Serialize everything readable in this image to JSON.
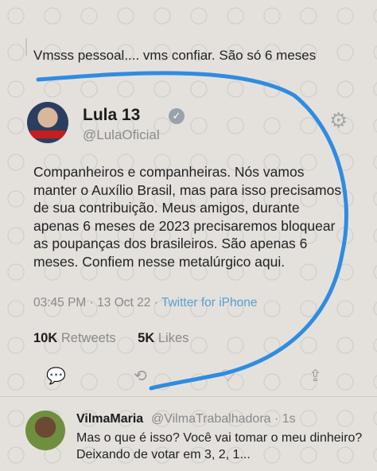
{
  "reply_context": {
    "text": "Vmsss pessoal.... vms confiar. São só 6 meses"
  },
  "author": {
    "display_name": "Lula 13",
    "handle": "@LulaOficial",
    "avatar_icon": "profile-photo",
    "verified_icon": "verified-badge-icon"
  },
  "tweet": {
    "text": "Companheiros e companheiras. Nós vamos manter o Auxílio Brasil, mas para isso precisamos de sua contribuição. Meus amigos, durante apenas 6 meses de 2023 precisaremos bloquear as poupanças dos brasileiros. São apenas 6 meses. Confiem nesse metalúrgico aqui.",
    "time": "03:45 PM",
    "date": "13 Oct 22",
    "source": "Twitter for iPhone"
  },
  "stats": {
    "retweets_count": "10K",
    "retweets_label": "Retweets",
    "likes_count": "5K",
    "likes_label": "Likes"
  },
  "reply": {
    "name": "VilmaMaria",
    "handle": "@VilmaTrabalhadora · 1s",
    "text": "Mas o que é isso? Você vai tomar o meu dinheiro? Deixando de votar em 3, 2, 1..."
  },
  "colors": {
    "scribble": "#2f8ce0",
    "link": "#5a9fd0"
  }
}
